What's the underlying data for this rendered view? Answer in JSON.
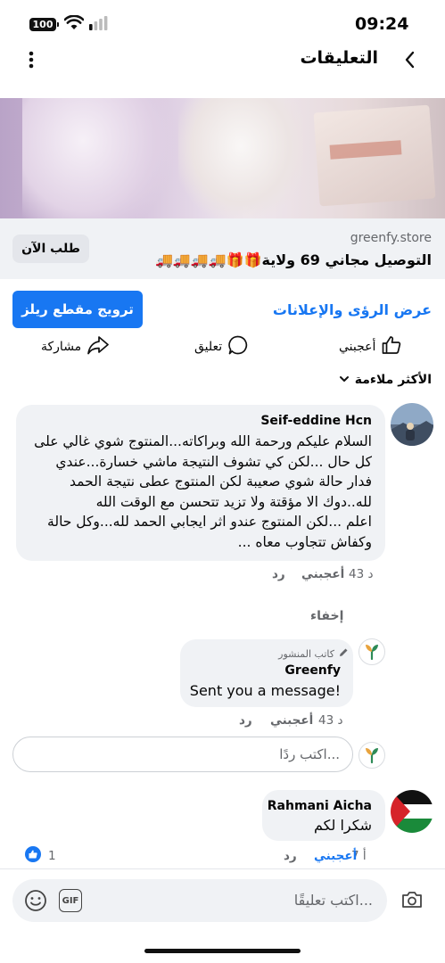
{
  "status_bar": {
    "time": "09:24",
    "battery": "100"
  },
  "header": {
    "title": "التعليقات"
  },
  "ad": {
    "domain": "greenfy.store",
    "promo_text": "التوصيل مجاني 69 ولاية🎁🎁🚚🚚🚚🚚",
    "order_button": "طلب الآن"
  },
  "actions": {
    "promote_button": "ترويج مقطع ريلز",
    "insights_link": "عرض الرؤى والإعلانات"
  },
  "reactions": {
    "like": "أعجبني",
    "comment": "تعليق",
    "share": "مشاركة"
  },
  "sort": {
    "label": "الأكثر ملاءمة"
  },
  "comments": [
    {
      "name": "Seif-eddine Hcn",
      "lines": [
        "السلام عليكم ورحمة الله وبراكاته...المنتوج شوي غالي على",
        "كل حال ...لكن كي تشوف النتيجة ماشي خسارة...عندي",
        "فدار حالة شوي صعيبة لكن المنتوج عطى نتيجة الحمد",
        "لله..دوك الا مؤقتة ولا تزيد تتحسن مع الوقت الله",
        "اعلم ...لكن المنتوج عندو اثر ايجابي الحمد لله...وكل حالة",
        "وكفاش تتجاوب معاه ..."
      ],
      "time": "43 د",
      "like": "أعجبني",
      "reply": "رد"
    }
  ],
  "hide_label": "إخفاء",
  "author_reply": {
    "badge": "كاتب المنشور",
    "name": "Greenfy",
    "text": "Sent you a message!",
    "time": "43 د",
    "like": "أعجبني",
    "reply": "رد"
  },
  "reply_input": {
    "placeholder": "اكتب ردًا..."
  },
  "comment2": {
    "name": "Rahmani Aicha",
    "text": "شكرا لكم",
    "time": "7 أ",
    "like": "أعجبني",
    "reply": "رد",
    "reaction_count": "1"
  },
  "composer": {
    "placeholder": "اكتب تعليقًا...",
    "gif_label": "GIF"
  },
  "colors": {
    "accent": "#1877f2",
    "bubble": "#f0f2f5",
    "muted": "#65676b",
    "brand_green": "#2e8b57"
  }
}
